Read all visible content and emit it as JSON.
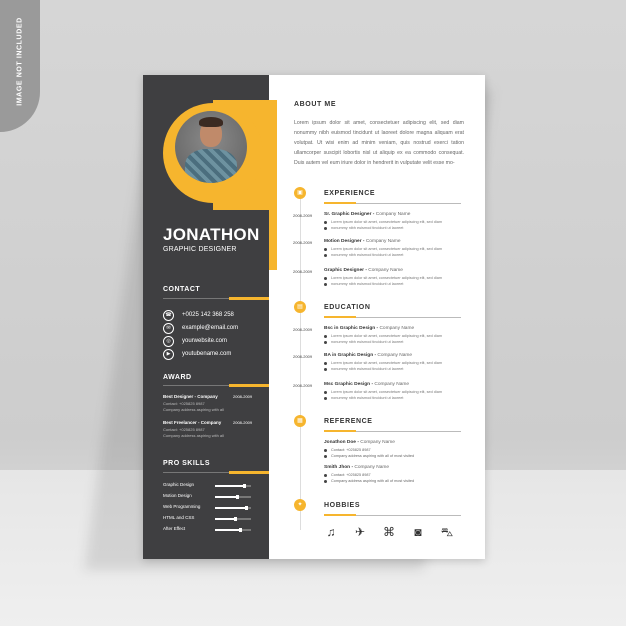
{
  "watermark": "IMAGE NOT INCLUDED",
  "sidebar": {
    "name": "JONATHON",
    "role": "GRAPHIC DESIGNER",
    "contact": {
      "title": "CONTACT",
      "items": [
        {
          "icon": "phone-icon",
          "text": "+0025 142 368 258"
        },
        {
          "icon": "email-icon",
          "text": "example@email.com"
        },
        {
          "icon": "globe-icon",
          "text": "yourwebsite.com"
        },
        {
          "icon": "youtube-icon",
          "text": "youtubename.com"
        }
      ]
    },
    "award": {
      "title": "AWARD",
      "items": [
        {
          "title": "Best Designer",
          "company": "Company",
          "date": "2008-2009",
          "line1": "Contact: +025825 8987",
          "line2": "Company address aspiring with all"
        },
        {
          "title": "Best Freelancer",
          "company": "Company",
          "date": "2008-2009",
          "line1": "Contact: +025825 8987",
          "line2": "Company address aspiring with all"
        }
      ]
    },
    "skills": {
      "title": "PRO SKILLS",
      "items": [
        {
          "name": "Graphic Design",
          "level": 0.8
        },
        {
          "name": "Motion Design",
          "level": 0.6
        },
        {
          "name": "Web Programming",
          "level": 0.85
        },
        {
          "name": "HTML and CSS",
          "level": 0.55
        },
        {
          "name": "After Effect",
          "level": 0.7
        }
      ]
    }
  },
  "main": {
    "about": {
      "title": "ABOUT ME",
      "text": "Lorem ipsum dolor sit amet, consectetuer adipiscing elit, sed diam nonummy nibh euismod tincidunt ut laoreet dolore magna aliquam erat volutpat. Ut wisi enim ad minim veniam, quis nostrud exerci tation ullamcorper suscipit lobortis nisl ut aliquip ex ea commodo consequat. Duis autem vel eum iriure dolor in hendrerit in vulputate velit esse mo-"
    },
    "experience": {
      "title": "EXPERIENCE",
      "items": [
        {
          "date": "2008-2009",
          "title": "Sr. Graphic Designer",
          "company": "Company Name",
          "b1": "Lorem ipsum dolor sit amet, consectetuer adipiscing elit, sed diam",
          "b2": "nonummy nibh euismod tincidunt ut laoreet"
        },
        {
          "date": "2008-2009",
          "title": "Motion Designer",
          "company": "Company Name",
          "b1": "Lorem ipsum dolor sit amet, consectetuer adipiscing elit, sed diam",
          "b2": "nonummy nibh euismod tincidunt ut laoreet"
        },
        {
          "date": "2008-2009",
          "title": "Graphic Designer",
          "company": "Company Name",
          "b1": "Lorem ipsum dolor sit amet, consectetuer adipiscing elit, sed diam",
          "b2": "nonummy nibh euismod tincidunt ut laoreet"
        }
      ]
    },
    "education": {
      "title": "EDUCATION",
      "items": [
        {
          "date": "2008-2009",
          "title": "Bsc in Graphic Design",
          "company": "Company Name",
          "b1": "Lorem ipsum dolor sit amet, consectetuer adipiscing elit, sed diam",
          "b2": "nonummy nibh euismod tincidunt ut laoreet"
        },
        {
          "date": "2008-2009",
          "title": "BA in Graphic Design",
          "company": "Company Name",
          "b1": "Lorem ipsum dolor sit amet, consectetuer adipiscing elit, sed diam",
          "b2": "nonummy nibh euismod tincidunt ut laoreet"
        },
        {
          "date": "2008-2009",
          "title": "Msc Graphic Design",
          "company": "Company Name",
          "b1": "Lorem ipsum dolor sit amet, consectetuer adipiscing elit, sed diam",
          "b2": "nonummy nibh euismod tincidunt ut laoreet"
        }
      ]
    },
    "reference": {
      "title": "REFERENCE",
      "items": [
        {
          "name": "Jonathon Doe",
          "company": "Company Name",
          "phone": "Contact: +025825 8987",
          "address": "Company address aspiring with all of most visited"
        },
        {
          "name": "Smith Jhon",
          "company": "Company Name",
          "phone": "Contact: +025825 8987",
          "address": "Company address aspiring with all of most visited"
        }
      ]
    },
    "hobbies": {
      "title": "HOBBIES",
      "icons": [
        "music-icon",
        "plane-icon",
        "gamepad-icon",
        "camera-icon",
        "car-icon"
      ]
    }
  },
  "colors": {
    "accent": "#f6b52e",
    "sidebar": "#3f3f41"
  }
}
